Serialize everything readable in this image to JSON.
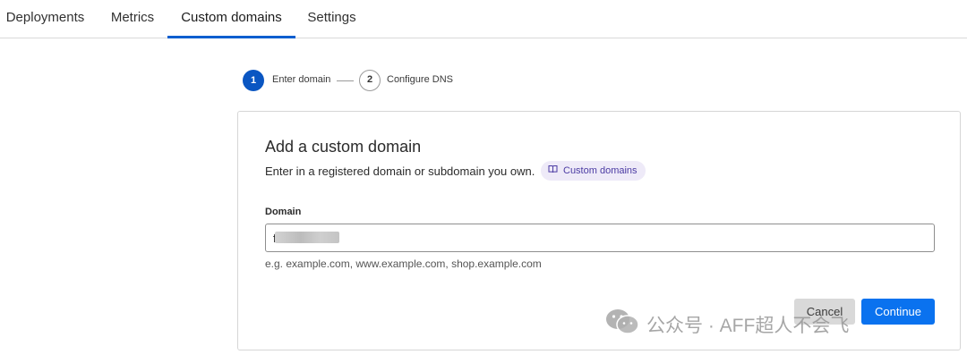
{
  "tabs": {
    "items": [
      {
        "label": "Deployments",
        "active": false
      },
      {
        "label": "Metrics",
        "active": false
      },
      {
        "label": "Custom domains",
        "active": true
      },
      {
        "label": "Settings",
        "active": false
      }
    ]
  },
  "stepper": {
    "steps": [
      {
        "number": "1",
        "label": "Enter domain",
        "state": "current"
      },
      {
        "number": "2",
        "label": "Configure DNS",
        "state": "upcoming"
      }
    ]
  },
  "card": {
    "title": "Add a custom domain",
    "description": "Enter in a registered domain or subdomain you own.",
    "docs_link": {
      "label": "Custom domains",
      "icon": "book-icon"
    },
    "field": {
      "label": "Domain",
      "value_prefix": "f",
      "value_suffix": "com",
      "value": "f          com",
      "hint": "e.g. example.com, www.example.com, shop.example.com"
    },
    "buttons": {
      "cancel": "Cancel",
      "continue": "Continue"
    }
  },
  "watermark": {
    "text": "公众号 · AFF超人不会飞",
    "icon": "wechat-icon"
  },
  "colors": {
    "accent": "#0a5ecf",
    "primary_button": "#0a72ef",
    "badge_bg": "#eeeaf8",
    "badge_text": "#4b3ba3"
  }
}
